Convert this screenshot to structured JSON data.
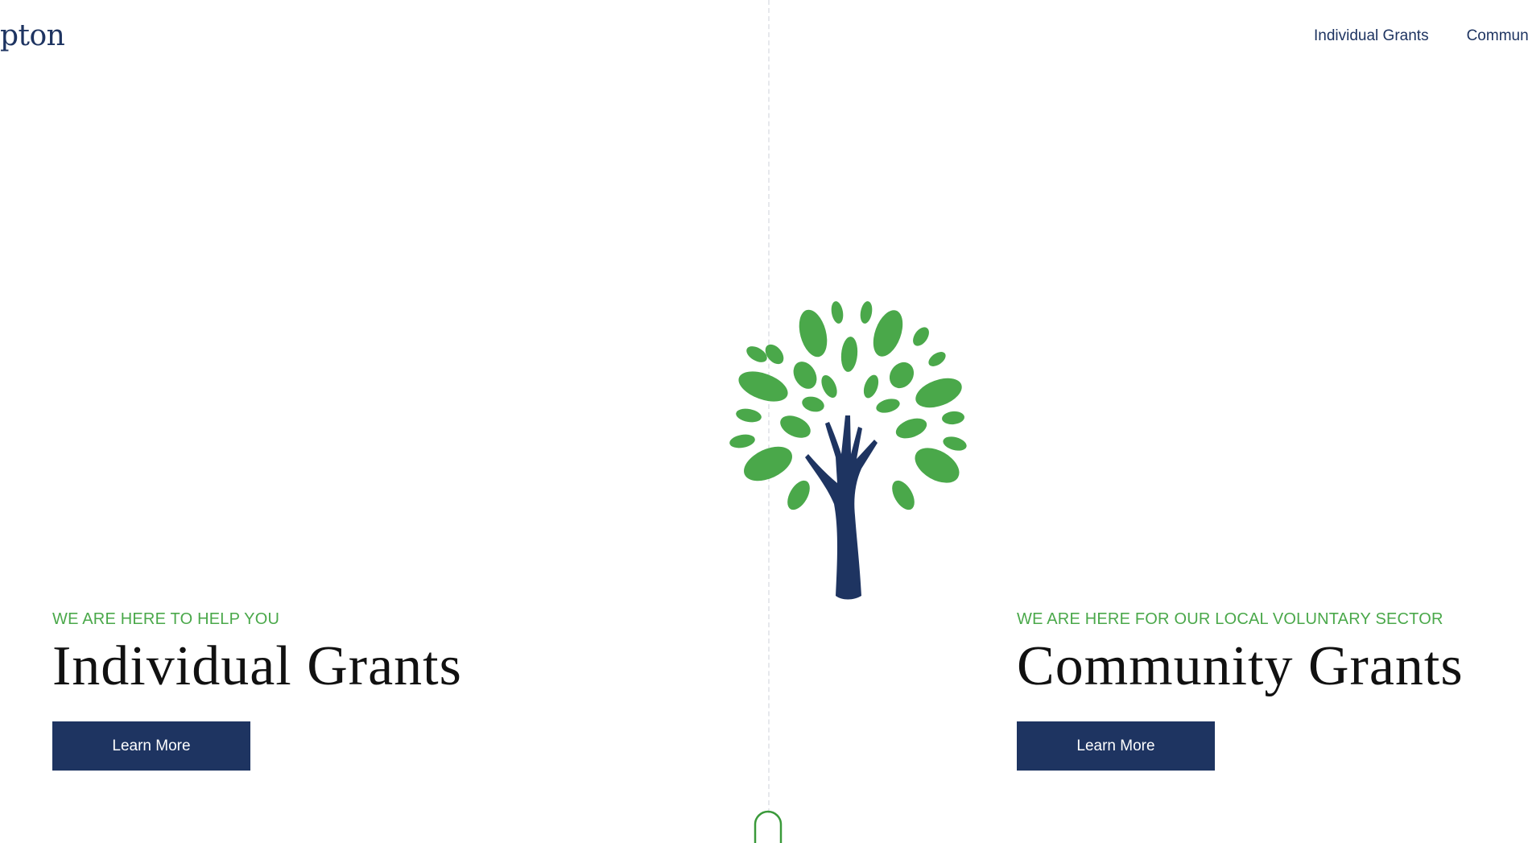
{
  "header": {
    "logo_text": "pton",
    "nav_items": [
      "Individual Grants",
      "Community Grants"
    ]
  },
  "sections": {
    "individual": {
      "eyebrow": "WE ARE HERE TO HELP YOU",
      "title": "Individual Grants",
      "button_label": "Learn More"
    },
    "community": {
      "eyebrow": "WE ARE HERE FOR OUR LOCAL VOLUNTARY SECTOR",
      "title": "Community Grants",
      "button_label": "Learn More"
    }
  },
  "icons": {
    "hero": "hand-tree-icon",
    "scroll": "scroll-down-icon"
  },
  "colors": {
    "brand_navy": "#1e3461",
    "leaf_green": "#4aa84a",
    "heading": "#111111",
    "background": "#ffffff"
  }
}
